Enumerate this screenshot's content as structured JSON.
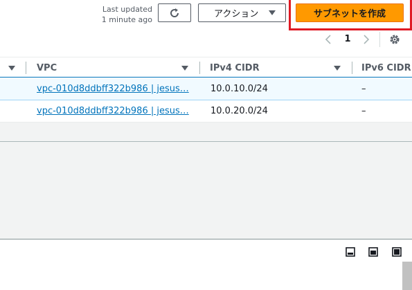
{
  "header": {
    "last_updated_line1": "Last updated",
    "last_updated_line2": "1 minute ago",
    "action_label": "アクション",
    "create_subnet_label": "サブネットを作成"
  },
  "pagination": {
    "current_page": "1"
  },
  "table": {
    "columns": [
      "VPC",
      "IPv4 CIDR",
      "IPv6 CIDR"
    ],
    "rows": [
      {
        "vpc": "vpc-010d8ddbff322b986 | jesus…",
        "ipv4": "10.0.10.0/24",
        "ipv6": "–"
      },
      {
        "vpc": "vpc-010d8ddbff322b986 | jesus…",
        "ipv4": "10.0.20.0/24",
        "ipv6": "–"
      }
    ]
  },
  "colors": {
    "primary": "#ff9900",
    "link": "#0073bb",
    "highlight": "#df1a24",
    "selected_row": "#f1faff"
  },
  "icons": [
    "refresh-icon",
    "caret-down-icon",
    "chevron-left-icon",
    "chevron-right-icon",
    "settings-gear-icon",
    "sort-caret-icon",
    "view-bottom-panel-icon",
    "view-split-icon",
    "view-full-icon"
  ]
}
